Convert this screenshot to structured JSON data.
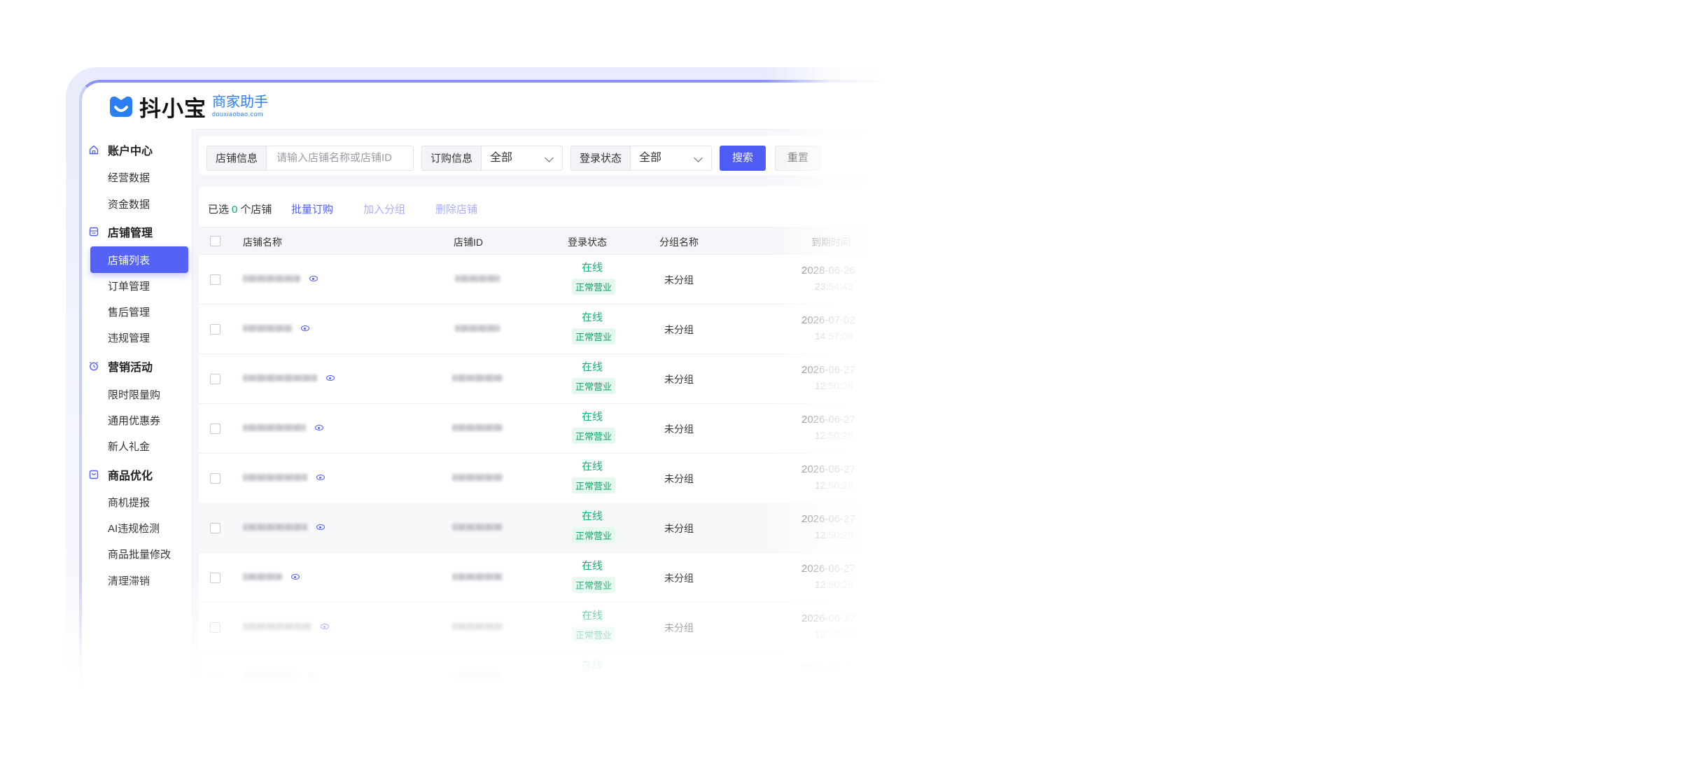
{
  "brand": {
    "name": "抖小宝",
    "subtitle": "商家助手",
    "domain": "douxiaobao.com",
    "accent": "#4d5cf5",
    "logo_color": "#2a7ef8"
  },
  "sidebar": {
    "groups": [
      {
        "label": "账户中心",
        "icon": "home-icon",
        "items": [
          "经营数据",
          "资金数据"
        ]
      },
      {
        "label": "店铺管理",
        "icon": "store-icon",
        "items": [
          "店铺列表",
          "订单管理",
          "售后管理",
          "违规管理"
        ]
      },
      {
        "label": "营销活动",
        "icon": "alarm-clock-icon",
        "items": [
          "限时限量购",
          "通用优惠券",
          "新人礼金"
        ]
      },
      {
        "label": "商品优化",
        "icon": "shopping-bag-icon",
        "items": [
          "商机提报",
          "AI违规检测",
          "商品批量修改",
          "清理滞销"
        ]
      }
    ],
    "active_item": "店铺列表"
  },
  "filters": {
    "shop_info_label": "店铺信息",
    "shop_info_placeholder": "请输入店铺名称或店铺ID",
    "order_info_label": "订购信息",
    "order_info_value": "全部",
    "login_status_label": "登录状态",
    "login_status_value": "全部",
    "search_label": "搜索",
    "reset_label": "重置"
  },
  "selection": {
    "prefix": "已选",
    "count": "0",
    "suffix": "个店铺",
    "batch_order": "批量订购",
    "add_group": "加入分组",
    "delete_shop": "删除店铺"
  },
  "table": {
    "columns": [
      "店铺名称",
      "店铺ID",
      "登录状态",
      "分组名称",
      "到期时间"
    ],
    "rows": [
      {
        "status": "在线",
        "business": "正常营业",
        "group": "未分组",
        "date": "2028-06-26",
        "time": "23:54:43"
      },
      {
        "status": "在线",
        "business": "正常营业",
        "group": "未分组",
        "date": "2026-07-02",
        "time": "14:57:08"
      },
      {
        "status": "在线",
        "business": "正常营业",
        "group": "未分组",
        "date": "2026-06-27",
        "time": "12:50:28"
      },
      {
        "status": "在线",
        "business": "正常营业",
        "group": "未分组",
        "date": "2026-06-27",
        "time": "12:50:28"
      },
      {
        "status": "在线",
        "business": "正常营业",
        "group": "未分组",
        "date": "2026-06-27",
        "time": "12:50:28"
      },
      {
        "status": "在线",
        "business": "正常营业",
        "group": "未分组",
        "date": "2026-06-27",
        "time": "12:50:28"
      },
      {
        "status": "在线",
        "business": "正常营业",
        "group": "未分组",
        "date": "2026-06-27",
        "time": "12:50:28"
      },
      {
        "status": "在线",
        "business": "正常营业",
        "group": "未分组",
        "date": "2026-06-27",
        "time": "12:50:28"
      },
      {
        "status": "在线",
        "business": "",
        "group": "",
        "date": "2026-06-27",
        "time": ""
      }
    ]
  }
}
